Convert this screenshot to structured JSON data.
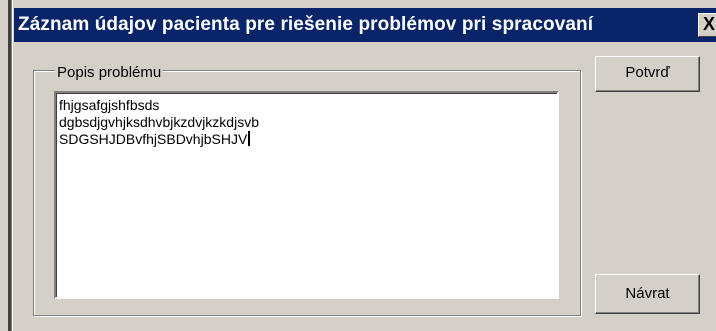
{
  "window": {
    "title": "Záznam údajov pacienta pre riešenie problémov pri spracovaní",
    "close_glyph": "X"
  },
  "groupbox": {
    "label": "Popis problému"
  },
  "textarea": {
    "lines": [
      "fhjgsafgjshfbsds",
      "dgbsdjgvhjksdhvbjkzdvjkzkdjsvb",
      "SDGSHJDBvfhjSBDvhjbSHJV"
    ]
  },
  "buttons": {
    "confirm": "Potvrď",
    "return": "Návrat"
  },
  "colors": {
    "titlebar": "#0a246a",
    "face": "#d4d0c8"
  }
}
